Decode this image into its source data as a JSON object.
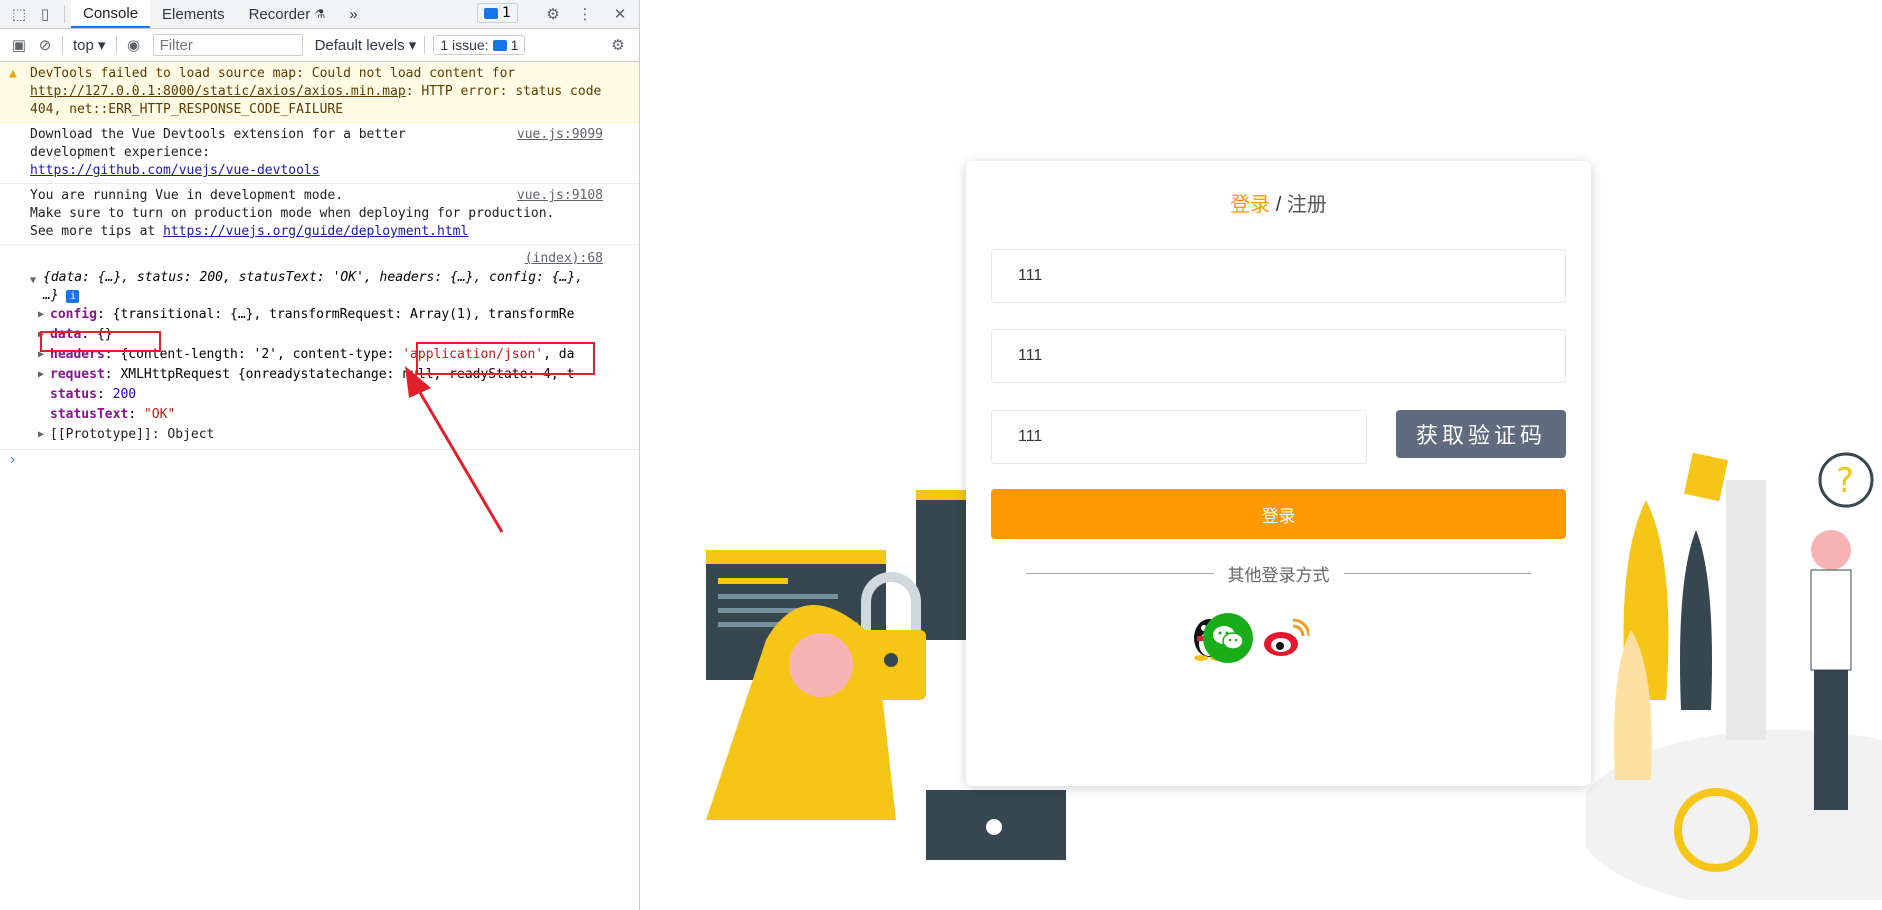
{
  "devtools": {
    "tabs": [
      "Console",
      "Elements",
      "Recorder",
      "»"
    ],
    "tab_msg_count": "1",
    "context": "top",
    "filter_placeholder": "Filter",
    "levels": "Default levels",
    "issues": "1 issue:",
    "issues_count": "1",
    "messages": [
      {
        "type": "warn",
        "text_prefix": "DevTools failed to load source map: Could not load content for ",
        "link": "http://127.0.0.1:8000/static/axios/axios.min.map",
        "text_suffix": ": HTTP error: status code 404, net::ERR_HTTP_RESPONSE_CODE_FAILURE"
      },
      {
        "type": "info",
        "text": "Download the Vue Devtools extension for a better development experience:",
        "link": "https://github.com/vuejs/vue-devtools",
        "source": "vue.js:9099"
      },
      {
        "type": "info",
        "text": "You are running Vue in development mode.",
        "text2": "Make sure to turn on production mode when deploying for production.",
        "text3": "See more tips at ",
        "link": "https://vuejs.org/guide/deployment.html",
        "source": "vue.js:9108"
      }
    ],
    "log": {
      "source": "(index):68",
      "summary": "{data: {…}, status: 200, statusText: 'OK', headers: {…}, config: {…}, …}",
      "config": "{transitional: {…}, transformRequest: Array(1), transformRe",
      "data": "{}",
      "headers_a": "{content-length: '2', content-type: ",
      "headers_b": "'application/json'",
      "headers_c": ", da",
      "request": "XMLHttpRequest {onreadystatechange: null, readyState: 4, t",
      "status": "200",
      "statusText": "\"OK\"",
      "prototype": "[[Prototype]]: Object"
    }
  },
  "login": {
    "tab_login": "登录",
    "sep": "/",
    "tab_register": "注册",
    "field1": "111",
    "field2": "111",
    "field3": "111",
    "code_button": "获取验证码",
    "login_button": "登录",
    "other": "其他登录方式"
  },
  "colors": {
    "accent": "#ff9900",
    "code_button": "#606b80",
    "wechat": "#19ad19",
    "error_red": "#e0202a"
  }
}
